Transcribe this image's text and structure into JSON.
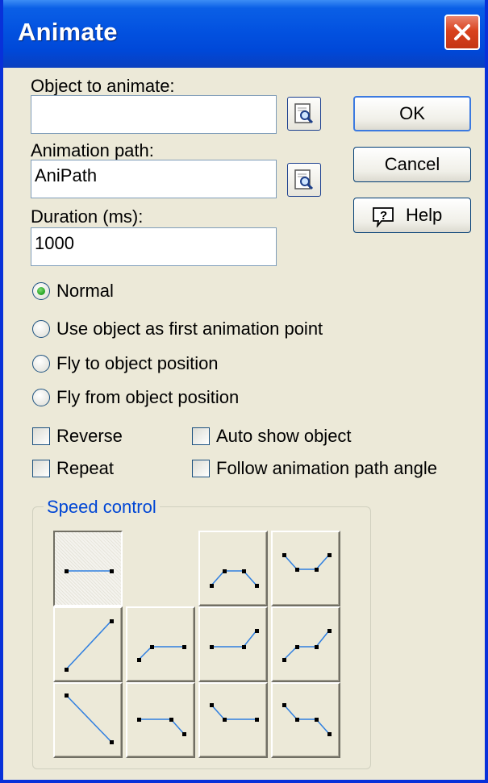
{
  "dialog": {
    "title": "Animate"
  },
  "fields": {
    "object_to_animate": {
      "label": "Object to animate:",
      "value": ""
    },
    "animation_path": {
      "label": "Animation path:",
      "value": "AniPath"
    },
    "duration": {
      "label": "Duration (ms):",
      "value": "1000"
    }
  },
  "buttons": {
    "ok": "OK",
    "cancel": "Cancel",
    "help": "Help"
  },
  "mode_options": [
    {
      "label": "Normal",
      "selected": true
    },
    {
      "label": "Use object as first animation point",
      "selected": false
    },
    {
      "label": "Fly to object position",
      "selected": false
    },
    {
      "label": "Fly from object position",
      "selected": false
    }
  ],
  "checkboxes": {
    "reverse": {
      "label": "Reverse",
      "checked": false
    },
    "repeat": {
      "label": "Repeat",
      "checked": false
    },
    "auto_show": {
      "label": "Auto show object",
      "checked": false
    },
    "follow_angle": {
      "label": "Follow animation path angle",
      "checked": false
    }
  },
  "speed_control": {
    "legend": "Speed control",
    "selected_preset": "constant",
    "presets": [
      "constant",
      "ease-in-out-peak",
      "ease-in-out-valley",
      "linear-rise",
      "rise-then-flat",
      "flat-then-rise",
      "rise-flat-rise",
      "linear-fall",
      "flat-then-fall",
      "fall-then-flat",
      "fall-flat-fall"
    ]
  },
  "colors": {
    "title_bar": "#0352e0",
    "dialog_bg": "#ece9d8",
    "accent_link": "#0046d5",
    "curve_line": "#2f7fe0"
  }
}
